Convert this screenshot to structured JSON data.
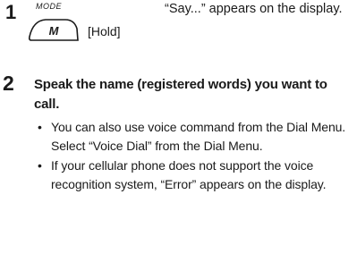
{
  "step1": {
    "number": "1",
    "mode_label": "MODE",
    "button_letter": "M",
    "hold_label": "[Hold]",
    "description": "“Say...” appears on the display."
  },
  "step2": {
    "number": "2",
    "heading": "Speak the name (registered words) you want to call.",
    "bullets": [
      "You can also use voice command from the Dial Menu. Select “Voice Dial” from the Dial Menu.",
      "If your cellular phone does not support the voice recognition system, “Error” appears on the display."
    ]
  }
}
